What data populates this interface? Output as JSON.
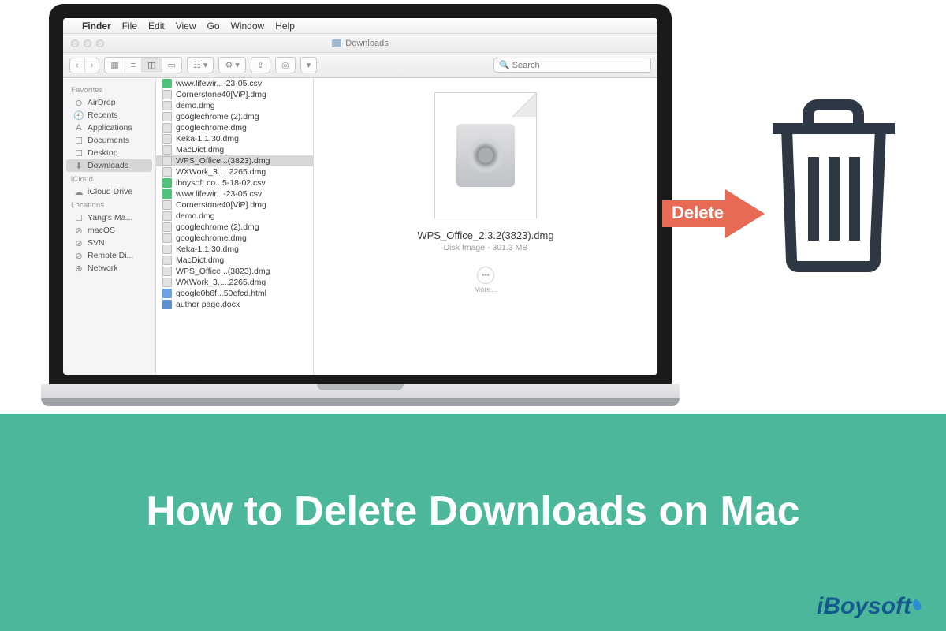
{
  "menubar": {
    "app": "Finder",
    "items": [
      "File",
      "Edit",
      "View",
      "Go",
      "Window",
      "Help"
    ]
  },
  "window": {
    "title": "Downloads"
  },
  "toolbar": {
    "search_placeholder": "Search"
  },
  "sidebar": {
    "sections": [
      {
        "head": "Favorites",
        "items": [
          {
            "icon": "⊙",
            "label": "AirDrop"
          },
          {
            "icon": "🕘",
            "label": "Recents"
          },
          {
            "icon": "A",
            "label": "Applications"
          },
          {
            "icon": "☐",
            "label": "Documents"
          },
          {
            "icon": "☐",
            "label": "Desktop"
          },
          {
            "icon": "⬇",
            "label": "Downloads",
            "selected": true
          }
        ]
      },
      {
        "head": "iCloud",
        "items": [
          {
            "icon": "☁",
            "label": "iCloud Drive"
          }
        ]
      },
      {
        "head": "Locations",
        "items": [
          {
            "icon": "☐",
            "label": "Yang's Ma..."
          },
          {
            "icon": "⊘",
            "label": "macOS"
          },
          {
            "icon": "⊘",
            "label": "SVN"
          },
          {
            "icon": "⊘",
            "label": "Remote Di..."
          },
          {
            "icon": "⊕",
            "label": "Network"
          }
        ]
      }
    ]
  },
  "files": [
    {
      "t": "csv",
      "n": "www.lifewir...-23-05.csv"
    },
    {
      "t": "dmg",
      "n": "Cornerstone40[ViP].dmg"
    },
    {
      "t": "dmg",
      "n": "demo.dmg"
    },
    {
      "t": "dmg",
      "n": "googlechrome (2).dmg"
    },
    {
      "t": "dmg",
      "n": "googlechrome.dmg"
    },
    {
      "t": "dmg",
      "n": "Keka-1.1.30.dmg"
    },
    {
      "t": "dmg",
      "n": "MacDict.dmg"
    },
    {
      "t": "dmg",
      "n": "WPS_Office...(3823).dmg",
      "selected": true
    },
    {
      "t": "dmg",
      "n": "WXWork_3.....2265.dmg"
    },
    {
      "t": "csv",
      "n": "iboysoft.co...5-18-02.csv"
    },
    {
      "t": "csv",
      "n": "www.lifewir...-23-05.csv"
    },
    {
      "t": "dmg",
      "n": "Cornerstone40[ViP].dmg"
    },
    {
      "t": "dmg",
      "n": "demo.dmg"
    },
    {
      "t": "dmg",
      "n": "googlechrome (2).dmg"
    },
    {
      "t": "dmg",
      "n": "googlechrome.dmg"
    },
    {
      "t": "dmg",
      "n": "Keka-1.1.30.dmg"
    },
    {
      "t": "dmg",
      "n": "MacDict.dmg"
    },
    {
      "t": "dmg",
      "n": "WPS_Office...(3823).dmg"
    },
    {
      "t": "dmg",
      "n": "WXWork_3.....2265.dmg"
    },
    {
      "t": "html",
      "n": "google0b6f...50efcd.html"
    },
    {
      "t": "docx",
      "n": "author page.docx"
    }
  ],
  "preview": {
    "name": "WPS_Office_2.3.2(3823).dmg",
    "sub": "Disk Image - 301.3 MB",
    "more": "More..."
  },
  "arrow": {
    "label": "Delete"
  },
  "footer": {
    "title": "How to Delete Downloads on Mac",
    "logo": "iBoysoft"
  }
}
